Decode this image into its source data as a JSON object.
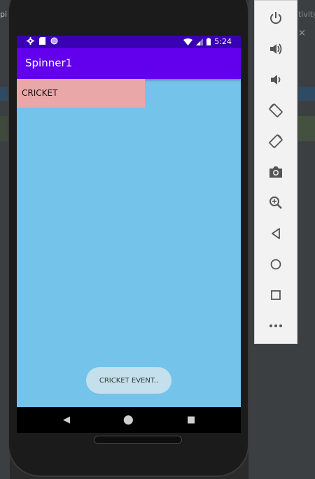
{
  "ide": {
    "left_text": "pi",
    "right_text": "tivity",
    "right_close": "×"
  },
  "status_bar": {
    "time": "5:24",
    "icons": [
      "gear-icon",
      "sd-card-icon",
      "circle-icon",
      "wifi-icon",
      "signal-icon",
      "battery-icon"
    ]
  },
  "app_bar": {
    "title": "Spinner1"
  },
  "spinner": {
    "selected": "CRICKET"
  },
  "toast": {
    "text": "CRICKET EVENT.."
  },
  "nav_bar": {
    "back": "◀",
    "home": "⬤",
    "recents": "■"
  },
  "toolbar": {
    "power": "⏻",
    "volume_up": "🔊",
    "volume_down": "🔉",
    "rotate_left": "⟲",
    "rotate_right": "⟳",
    "camera": "📷",
    "zoom": "🔍",
    "back": "◁",
    "home": "○",
    "overview": "□",
    "more": "•••"
  },
  "colors": {
    "screen_bg": "#74c3ea",
    "status_bar": "#3a00b3",
    "app_bar": "#6200ee",
    "spinner_bg": "#eaa7a8",
    "toast_bg": "#c4e0ec"
  }
}
